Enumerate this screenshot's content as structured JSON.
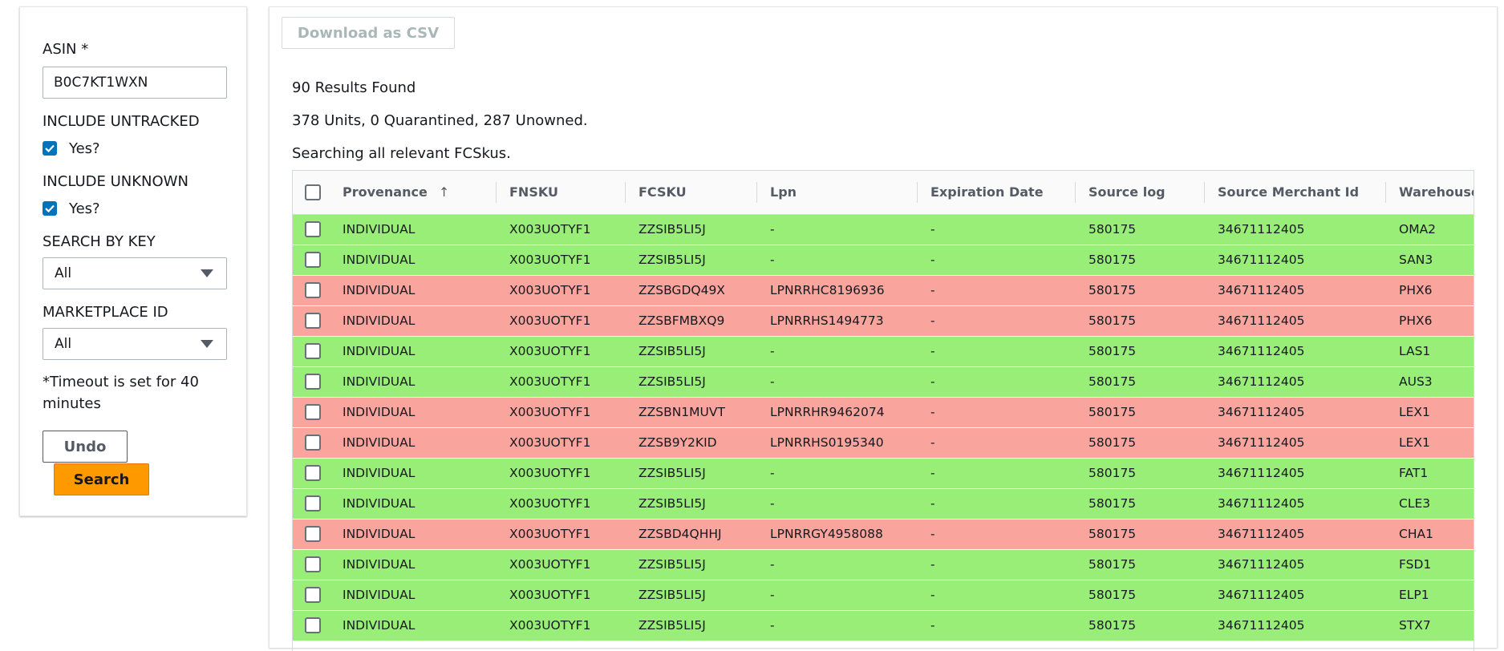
{
  "search_panel": {
    "asin_label": "ASIN *",
    "asin_value": "B0C7KT1WXN",
    "include_untracked_label": "INCLUDE UNTRACKED",
    "include_untracked_option": "Yes?",
    "include_untracked_checked": true,
    "include_unknown_label": "INCLUDE UNKNOWN",
    "include_unknown_option": "Yes?",
    "include_unknown_checked": true,
    "search_by_key_label": "SEARCH BY KEY",
    "search_by_key_value": "All",
    "marketplace_label": "MARKETPLACE ID",
    "marketplace_value": "All",
    "timeout_note": "*Timeout is set for 40 minutes",
    "undo_label": "Undo",
    "search_label": "Search"
  },
  "results": {
    "download_label": "Download as CSV",
    "count_text": "90 Results Found",
    "units_text": "378 Units, 0 Quarantined, 287 Unowned.",
    "searching_text": "Searching all relevant FCSkus."
  },
  "colors": {
    "owned_row": "#99ee77",
    "unowned_row": "#f9a49c",
    "primary_button": "#ff9900",
    "checkbox_checked": "#0073bb"
  },
  "table": {
    "columns": [
      "Provenance",
      "FNSKU",
      "FCSKU",
      "Lpn",
      "Expiration Date",
      "Source log",
      "Source Merchant Id",
      "Warehouse Id"
    ],
    "sort_icon": "arrow-up-icon",
    "rows": [
      {
        "status": "green",
        "cells": [
          "INDIVIDUAL",
          "X003UOTYF1",
          "ZZSIB5LI5J",
          "-",
          "-",
          "580175",
          "34671112405",
          "OMA2"
        ]
      },
      {
        "status": "green",
        "cells": [
          "INDIVIDUAL",
          "X003UOTYF1",
          "ZZSIB5LI5J",
          "-",
          "-",
          "580175",
          "34671112405",
          "SAN3"
        ]
      },
      {
        "status": "red",
        "cells": [
          "INDIVIDUAL",
          "X003UOTYF1",
          "ZZSBGDQ49X",
          "LPNRRHC8196936",
          "-",
          "580175",
          "34671112405",
          "PHX6"
        ]
      },
      {
        "status": "red",
        "cells": [
          "INDIVIDUAL",
          "X003UOTYF1",
          "ZZSBFMBXQ9",
          "LPNRRHS1494773",
          "-",
          "580175",
          "34671112405",
          "PHX6"
        ]
      },
      {
        "status": "green",
        "cells": [
          "INDIVIDUAL",
          "X003UOTYF1",
          "ZZSIB5LI5J",
          "-",
          "-",
          "580175",
          "34671112405",
          "LAS1"
        ]
      },
      {
        "status": "green",
        "cells": [
          "INDIVIDUAL",
          "X003UOTYF1",
          "ZZSIB5LI5J",
          "-",
          "-",
          "580175",
          "34671112405",
          "AUS3"
        ]
      },
      {
        "status": "red",
        "cells": [
          "INDIVIDUAL",
          "X003UOTYF1",
          "ZZSBN1MUVT",
          "LPNRRHR9462074",
          "-",
          "580175",
          "34671112405",
          "LEX1"
        ]
      },
      {
        "status": "red",
        "cells": [
          "INDIVIDUAL",
          "X003UOTYF1",
          "ZZSB9Y2KID",
          "LPNRRHS0195340",
          "-",
          "580175",
          "34671112405",
          "LEX1"
        ]
      },
      {
        "status": "green",
        "cells": [
          "INDIVIDUAL",
          "X003UOTYF1",
          "ZZSIB5LI5J",
          "-",
          "-",
          "580175",
          "34671112405",
          "FAT1"
        ]
      },
      {
        "status": "green",
        "cells": [
          "INDIVIDUAL",
          "X003UOTYF1",
          "ZZSIB5LI5J",
          "-",
          "-",
          "580175",
          "34671112405",
          "CLE3"
        ]
      },
      {
        "status": "red",
        "cells": [
          "INDIVIDUAL",
          "X003UOTYF1",
          "ZZSBD4QHHJ",
          "LPNRRGY4958088",
          "-",
          "580175",
          "34671112405",
          "CHA1"
        ]
      },
      {
        "status": "green",
        "cells": [
          "INDIVIDUAL",
          "X003UOTYF1",
          "ZZSIB5LI5J",
          "-",
          "-",
          "580175",
          "34671112405",
          "FSD1"
        ]
      },
      {
        "status": "green",
        "cells": [
          "INDIVIDUAL",
          "X003UOTYF1",
          "ZZSIB5LI5J",
          "-",
          "-",
          "580175",
          "34671112405",
          "ELP1"
        ]
      },
      {
        "status": "green",
        "cells": [
          "INDIVIDUAL",
          "X003UOTYF1",
          "ZZSIB5LI5J",
          "-",
          "-",
          "580175",
          "34671112405",
          "STX7"
        ]
      }
    ]
  }
}
